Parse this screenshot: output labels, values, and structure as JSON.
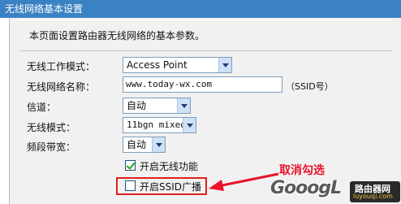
{
  "title": "无线网络基本设置",
  "intro": "本页面设置路由器无线网络的基本参数。",
  "form": {
    "mode_label": "无线工作模式：",
    "mode_value": "Access Point",
    "ssid_label": "无线网络名称：",
    "ssid_value": "www.today-wx.com",
    "ssid_hint": "（SSID号）",
    "channel_label": "信道：",
    "channel_value": "自动",
    "wireless_mode_label": "无线模式：",
    "wireless_mode_value": "11bgn mixed",
    "bandwidth_label": "频段带宽：",
    "bandwidth_value": "自动",
    "enable_wireless_label": "开启无线功能",
    "enable_wireless_checked": true,
    "broadcast_ssid_label": "开启SSID广播",
    "broadcast_ssid_checked": false
  },
  "annotation": "取消勾选",
  "watermark": {
    "text": "GooogL",
    "badge_cn": "路由器网",
    "badge_url": "luyouqi.com"
  },
  "colors": {
    "titlebar": "#3b82c4",
    "annotation": "#e8132a",
    "checkmark": "#21a121"
  }
}
